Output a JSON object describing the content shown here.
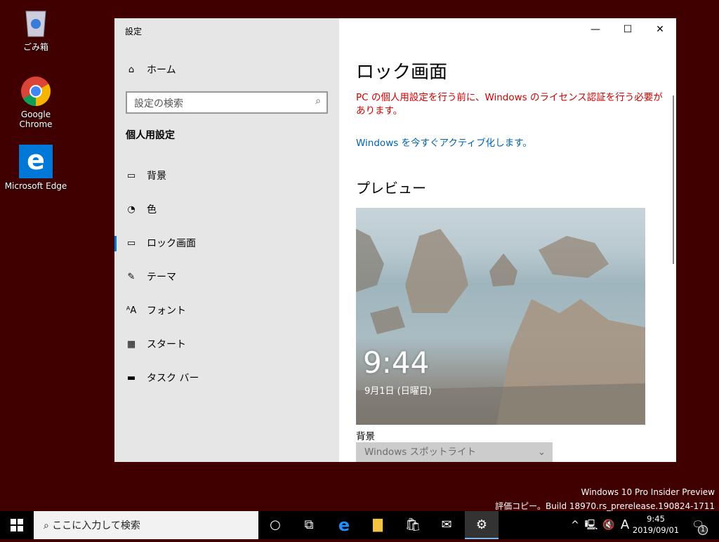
{
  "desktop": {
    "icons": [
      {
        "label": "ごみ箱",
        "icon": "recycle-bin-icon"
      },
      {
        "label": "Google Chrome",
        "icon": "chrome-icon"
      },
      {
        "label": "Microsoft Edge",
        "icon": "edge-icon"
      }
    ]
  },
  "settings": {
    "window_title": "設定",
    "home": "ホーム",
    "search_placeholder": "設定の検索",
    "section": "個人用設定",
    "nav": [
      {
        "label": "背景",
        "icon": "picture-icon"
      },
      {
        "label": "色",
        "icon": "palette-icon"
      },
      {
        "label": "ロック画面",
        "icon": "lock-screen-icon",
        "selected": true
      },
      {
        "label": "テーマ",
        "icon": "theme-icon"
      },
      {
        "label": "フォント",
        "icon": "font-icon"
      },
      {
        "label": "スタート",
        "icon": "start-icon"
      },
      {
        "label": "タスク バー",
        "icon": "taskbar-icon"
      }
    ],
    "page_title": "ロック画面",
    "warning": "PC の個人用設定を行う前に、Windows のライセンス認証を行う必要があります。",
    "activate_link": "Windows を今すぐアクティブ化します。",
    "preview_heading": "プレビュー",
    "preview_time": "9:44",
    "preview_date": "9月1日 (日曜日)",
    "background_label": "背景",
    "background_value": "Windows スポットライト",
    "colors": {
      "accent": "#0078d7",
      "warning": "#d00000",
      "link": "#0063b1"
    }
  },
  "watermark": {
    "line1": "Windows 10 Pro Insider Preview",
    "line2": "評価コピー。Build 18970.rs_prerelease.190824-1711"
  },
  "taskbar": {
    "search_placeholder": "ここに入力して検索",
    "time": "9:45",
    "date": "2019/09/01",
    "ime": "A",
    "notifications": "1"
  }
}
